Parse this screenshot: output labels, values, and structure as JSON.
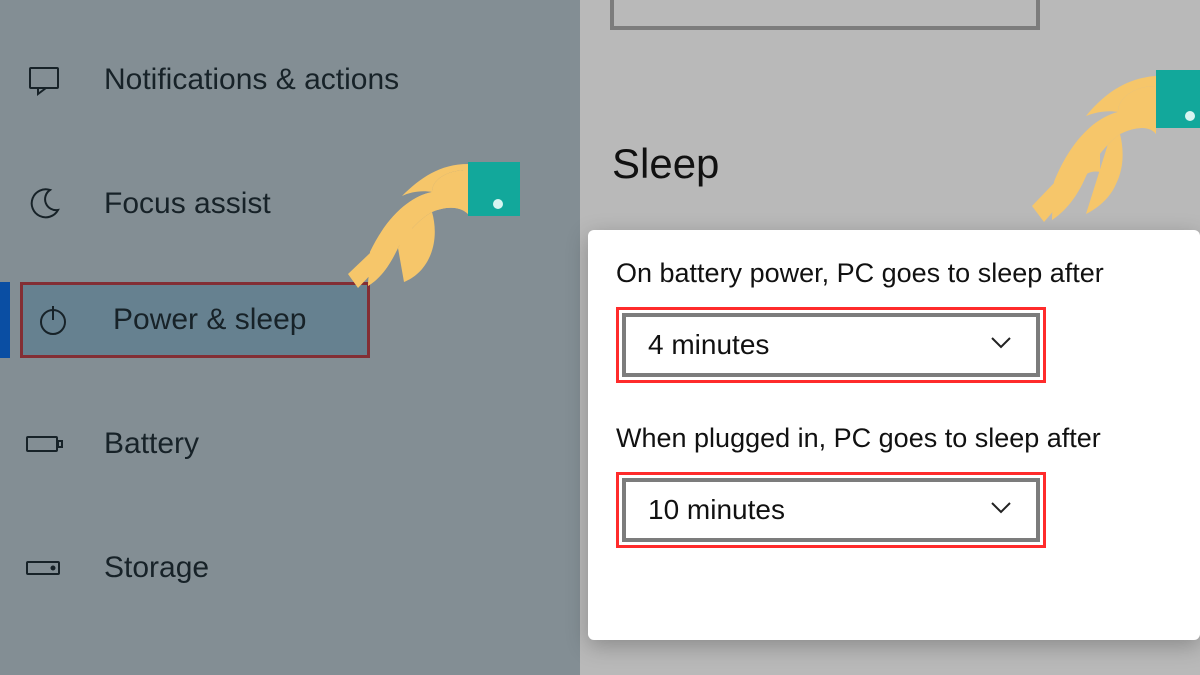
{
  "sidebar": {
    "items": [
      {
        "label": "Notifications & actions"
      },
      {
        "label": "Focus assist"
      },
      {
        "label": "Power & sleep"
      },
      {
        "label": "Battery"
      },
      {
        "label": "Storage"
      }
    ]
  },
  "main": {
    "section_title": "Sleep",
    "battery_label": "On battery power, PC goes to sleep after",
    "battery_value": "4 minutes",
    "plugged_label": "When plugged in, PC goes to sleep after",
    "plugged_value": "10 minutes"
  },
  "colors": {
    "highlight": "#ff2b2b",
    "selected_bg": "#bfe3f7",
    "accent": "#0a4ea3",
    "overlay_left": "rgba(30,50,60,0.55)",
    "overlay_right": "rgba(80,80,80,0.40)"
  }
}
